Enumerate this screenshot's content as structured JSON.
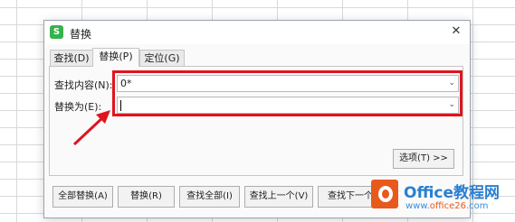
{
  "dialog": {
    "title": "替换",
    "app_icon": "S",
    "close_glyph": "✕"
  },
  "tabs": [
    {
      "label": "查找(D)",
      "active": false
    },
    {
      "label": "替换(P)",
      "active": true
    },
    {
      "label": "定位(G)",
      "active": false
    }
  ],
  "find": {
    "label": "查找内容(N):",
    "value": "0*"
  },
  "replace": {
    "label": "替换为(E):",
    "value": ""
  },
  "options_label": "选项(T) >>",
  "buttons": {
    "replace_all": "全部替换(A)",
    "replace": "替换(R)",
    "find_all": "查找全部(I)",
    "find_prev": "查找上一个(V)",
    "find_next": "查找下一个"
  },
  "watermark": {
    "title": "Office教程网",
    "url_prefix": "www.",
    "url_highlight": "office26",
    "url_suffix": ".com"
  },
  "annotation_color": "#e0141e"
}
